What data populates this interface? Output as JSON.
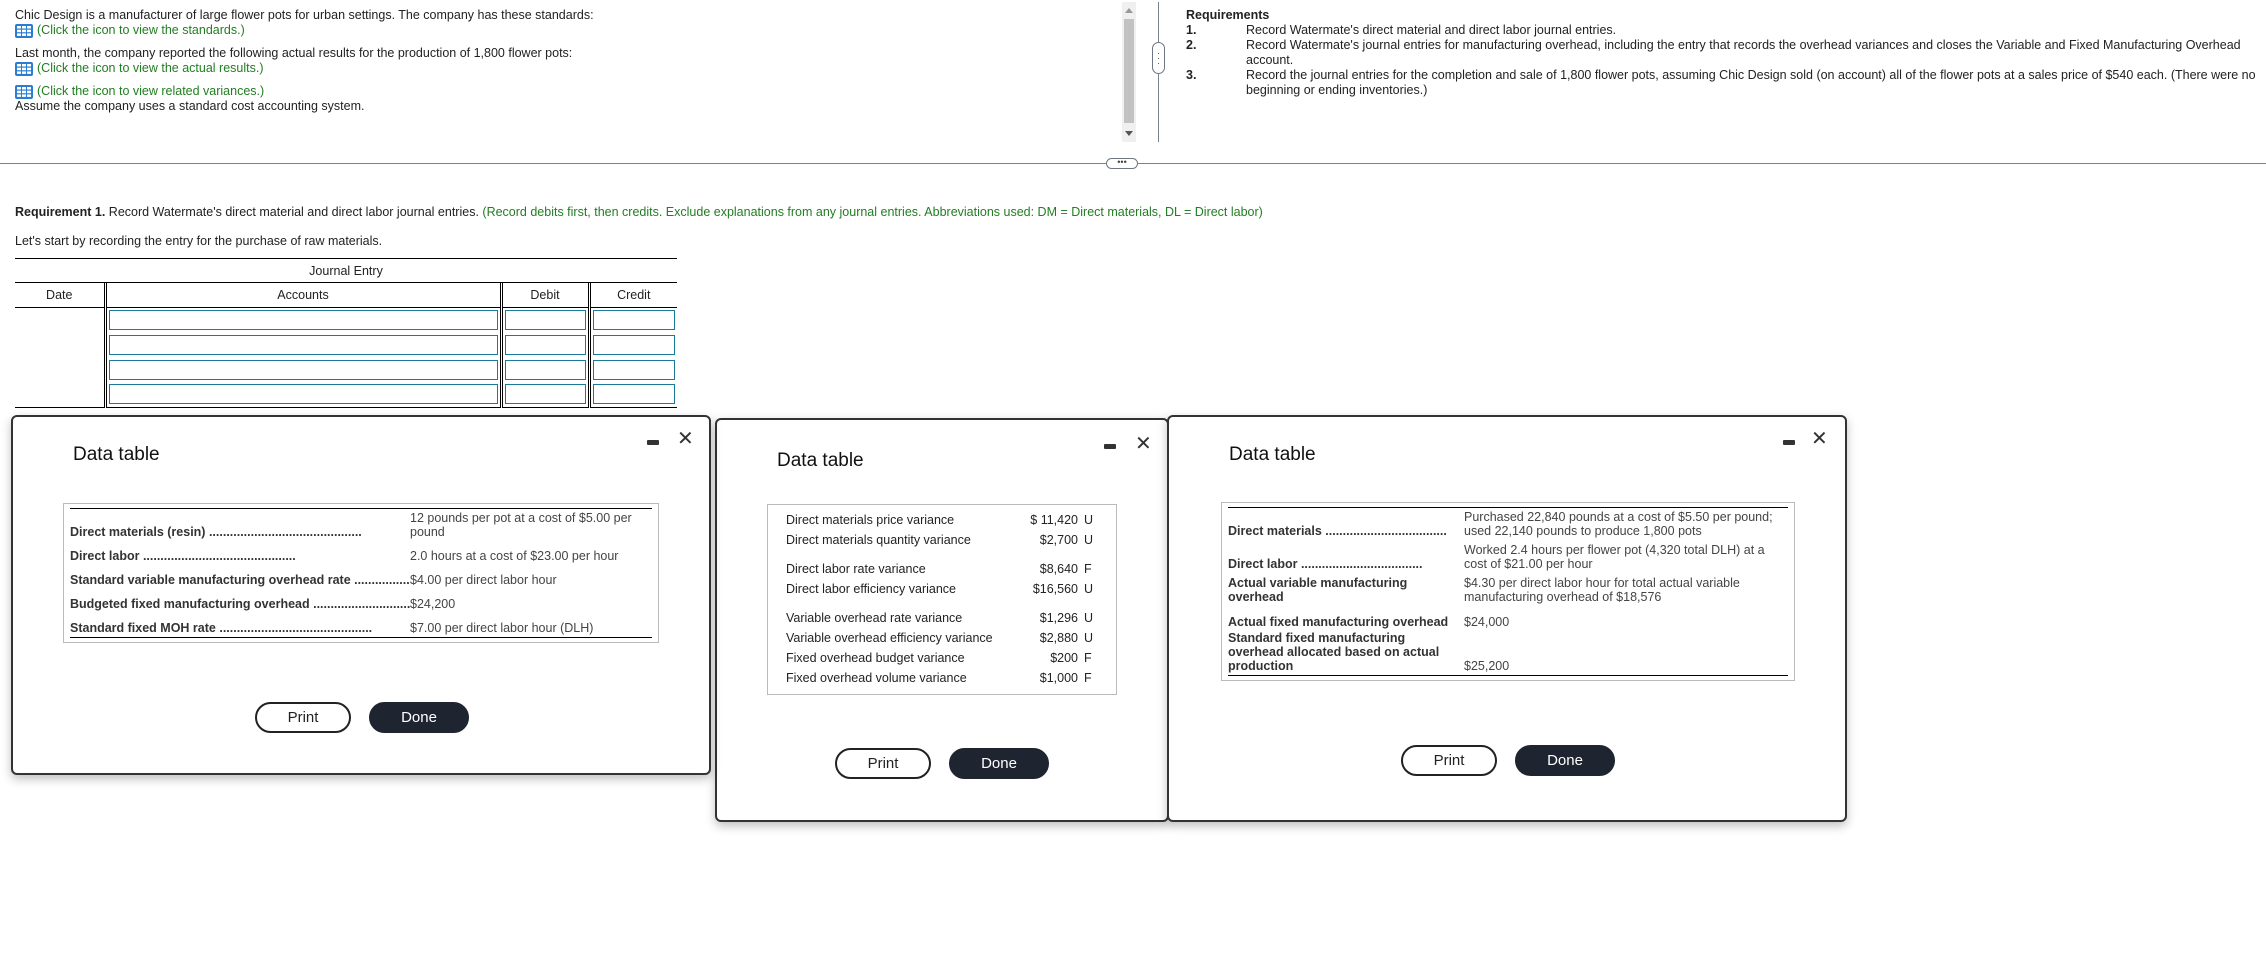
{
  "problem": {
    "intro": "Chic Design is a manufacturer of large flower pots for urban settings. The company has these standards:",
    "link_standards": "(Click the icon to view the standards.)",
    "actual_intro": "Last month, the company reported the following actual results for the production of 1,800 flower pots:",
    "link_actual": "(Click the icon to view the actual results.)",
    "link_variances": "(Click the icon to view related variances.)",
    "assume": "Assume the company uses a standard cost accounting system."
  },
  "requirements": {
    "title": "Requirements",
    "items": [
      {
        "num": "1.",
        "text": "Record Watermate's direct material and direct labor journal entries."
      },
      {
        "num": "2.",
        "text": "Record Watermate's journal entries for manufacturing overhead, including the entry that records the overhead variances and closes the Variable and Fixed Manufacturing Overhead account."
      },
      {
        "num": "3.",
        "text": "Record the journal entries for the completion and sale of 1,800 flower pots, assuming Chic Design sold (on account) all of the flower pots at a sales price of $540 each. (There were no beginning or ending inventories.)"
      }
    ]
  },
  "requirement1": {
    "label": "Requirement 1.",
    "text": " Record Watermate's direct material and direct labor journal entries. ",
    "instructions": "(Record debits first, then credits. Exclude explanations from any journal entries. Abbreviations used: DM = Direct materials, DL = Direct labor)",
    "sub": "Let's start by recording the entry for the purchase of raw materials."
  },
  "journal": {
    "title": "Journal Entry",
    "columns": [
      "Date",
      "Accounts",
      "Debit",
      "Credit"
    ],
    "rows": [
      {
        "account": "",
        "debit": "",
        "credit": ""
      },
      {
        "account": "",
        "debit": "",
        "credit": ""
      },
      {
        "account": "",
        "debit": "",
        "credit": ""
      },
      {
        "account": "",
        "debit": "",
        "credit": ""
      }
    ]
  },
  "dialogs": {
    "standards": {
      "title": "Data table",
      "rows": [
        {
          "label": "Direct materials (resin)",
          "value": "12 pounds per pot at a cost of $5.00 per pound"
        },
        {
          "label": "Direct labor",
          "value": "2.0 hours at a cost of $23.00 per hour"
        },
        {
          "label": "Standard variable manufacturing overhead rate",
          "value": "$4.00 per direct labor hour"
        },
        {
          "label": "Budgeted fixed manufacturing overhead",
          "value": "$24,200"
        },
        {
          "label": "Standard fixed MOH rate",
          "value": "$7.00 per direct labor hour (DLH)"
        }
      ],
      "print": "Print",
      "done": "Done"
    },
    "variances": {
      "title": "Data table",
      "groups": [
        [
          {
            "label": "Direct materials price variance",
            "value": "$ 11,420",
            "flag": "U"
          },
          {
            "label": "Direct materials quantity variance",
            "value": "$2,700",
            "flag": "U"
          }
        ],
        [
          {
            "label": "Direct labor rate variance",
            "value": "$8,640",
            "flag": "F"
          },
          {
            "label": "Direct labor efficiency variance",
            "value": "$16,560",
            "flag": "U"
          }
        ],
        [
          {
            "label": "Variable overhead rate variance",
            "value": "$1,296",
            "flag": "U"
          },
          {
            "label": "Variable overhead efficiency variance",
            "value": "$2,880",
            "flag": "U"
          },
          {
            "label": "Fixed overhead budget variance",
            "value": "$200",
            "flag": "F"
          },
          {
            "label": "Fixed overhead volume variance",
            "value": "$1,000",
            "flag": "F"
          }
        ]
      ],
      "print": "Print",
      "done": "Done"
    },
    "actual": {
      "title": "Data table",
      "rows": [
        {
          "label": "Direct materials",
          "value": "Purchased 22,840 pounds at a cost of $5.50 per pound; used 22,140 pounds to produce 1,800 pots"
        },
        {
          "label": "Direct labor",
          "value": "Worked 2.4 hours per flower pot (4,320 total DLH) at a cost of $21.00 per hour"
        },
        {
          "label": "Actual variable manufacturing overhead",
          "value": "$4.30 per direct labor hour for total actual variable manufacturing overhead of $18,576"
        },
        {
          "label": "Actual fixed manufacturing overhead",
          "value": "$24,000"
        },
        {
          "label": "Standard fixed manufacturing overhead allocated based on actual production",
          "value": "$25,200"
        }
      ],
      "print": "Print",
      "done": "Done"
    }
  },
  "colors": {
    "instruction_green": "#217e21",
    "icon_blue": "#2b7cd3",
    "input_border": "#1a7a9a",
    "done_button": "#1e2430"
  }
}
